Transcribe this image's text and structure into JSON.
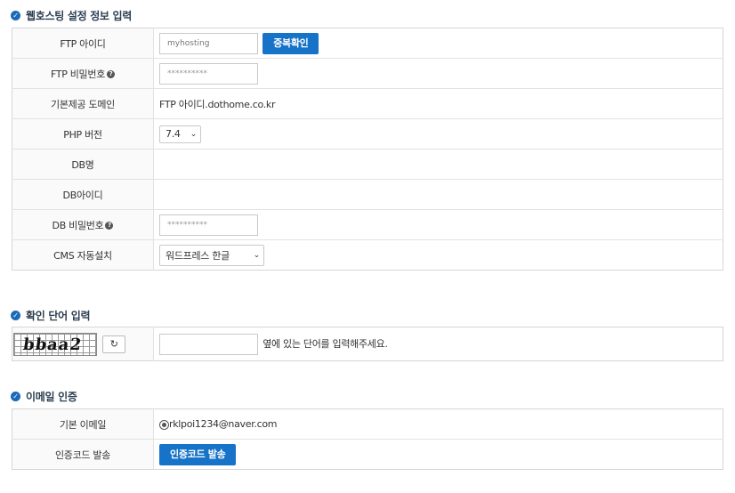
{
  "section_hosting": {
    "title": "웹호스팅 설정 정보 입력"
  },
  "ftp_id": {
    "label": "FTP 아이디",
    "placeholder": "myhosting",
    "check_button": "중복확인"
  },
  "ftp_password": {
    "label": "FTP 비밀번호",
    "value": "**********"
  },
  "default_domain": {
    "label": "기본제공 도메인",
    "value": "FTP 아이디.dothome.co.kr"
  },
  "php_version": {
    "label": "PHP 버전",
    "selected": "7.4"
  },
  "db_name": {
    "label": "DB명",
    "value": ""
  },
  "db_id": {
    "label": "DB아이디",
    "value": ""
  },
  "db_password": {
    "label": "DB 비밀번호",
    "value": "**********"
  },
  "cms_install": {
    "label": "CMS 자동설치",
    "selected": "워드프레스 한글"
  },
  "section_captcha": {
    "title": "확인 단어 입력"
  },
  "captcha": {
    "image_text": "bbaa2",
    "refresh_symbol": "↻",
    "hint": "옆에 있는 단어를 입력해주세요."
  },
  "section_email": {
    "title": "이메일 인증"
  },
  "email": {
    "label": "기본 이메일",
    "value": "rklpoi1234@naver.com"
  },
  "auth_code": {
    "label": "인증코드 발송",
    "button": "인증코드 발송"
  },
  "icons": {
    "section": "check-circle-icon",
    "help": "question-circle-icon",
    "select": "chevron-down-icon",
    "refresh": "refresh-icon"
  },
  "colors": {
    "accent": "#1773c7",
    "title": "#2c3e50"
  }
}
